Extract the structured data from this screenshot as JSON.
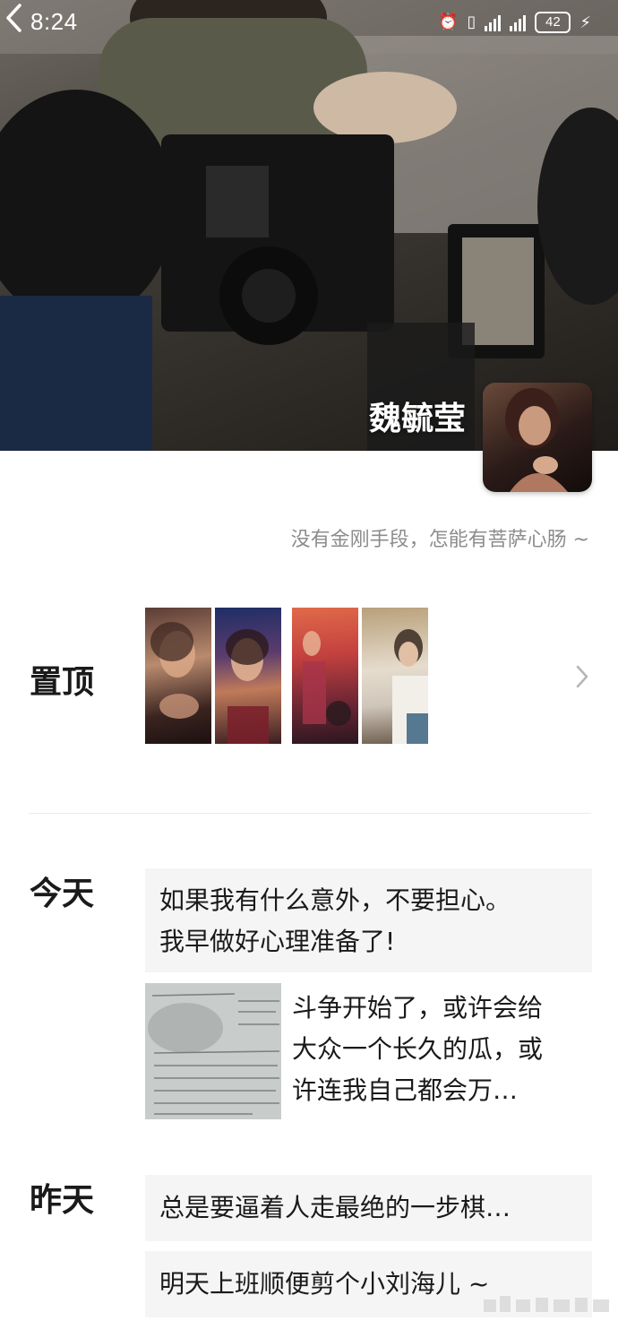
{
  "status_bar": {
    "time": "8:24",
    "battery": "42",
    "icons": [
      "alarm-icon",
      "vibrate-icon",
      "signal-icon",
      "signal-icon",
      "battery-icon",
      "charging-icon"
    ]
  },
  "profile": {
    "name": "魏毓莹",
    "signature": "没有金刚手段，怎能有菩萨心肠 ~"
  },
  "pinned": {
    "label": "置顶",
    "photos": [
      "portrait-1",
      "portrait-2",
      "stage-photo",
      "portrait-3"
    ]
  },
  "today": {
    "label": "今天",
    "post1": {
      "line1": "如果我有什么意外，不要担心。",
      "line2": "我早做好心理准备了!"
    },
    "post2": {
      "line1": "斗争开始了，或许会给",
      "line2": "大众一个长久的瓜，或",
      "line3": "许连我自己都会万…"
    }
  },
  "yesterday": {
    "label": "昨天",
    "post1": "总是要逼着人走最绝的一步棋…",
    "post2": "明天上班顺便剪个小刘海儿 ~"
  },
  "colors": {
    "post_background": "#f5f5f5",
    "signature_text": "#8c8c8c",
    "divider": "#ebebeb"
  }
}
